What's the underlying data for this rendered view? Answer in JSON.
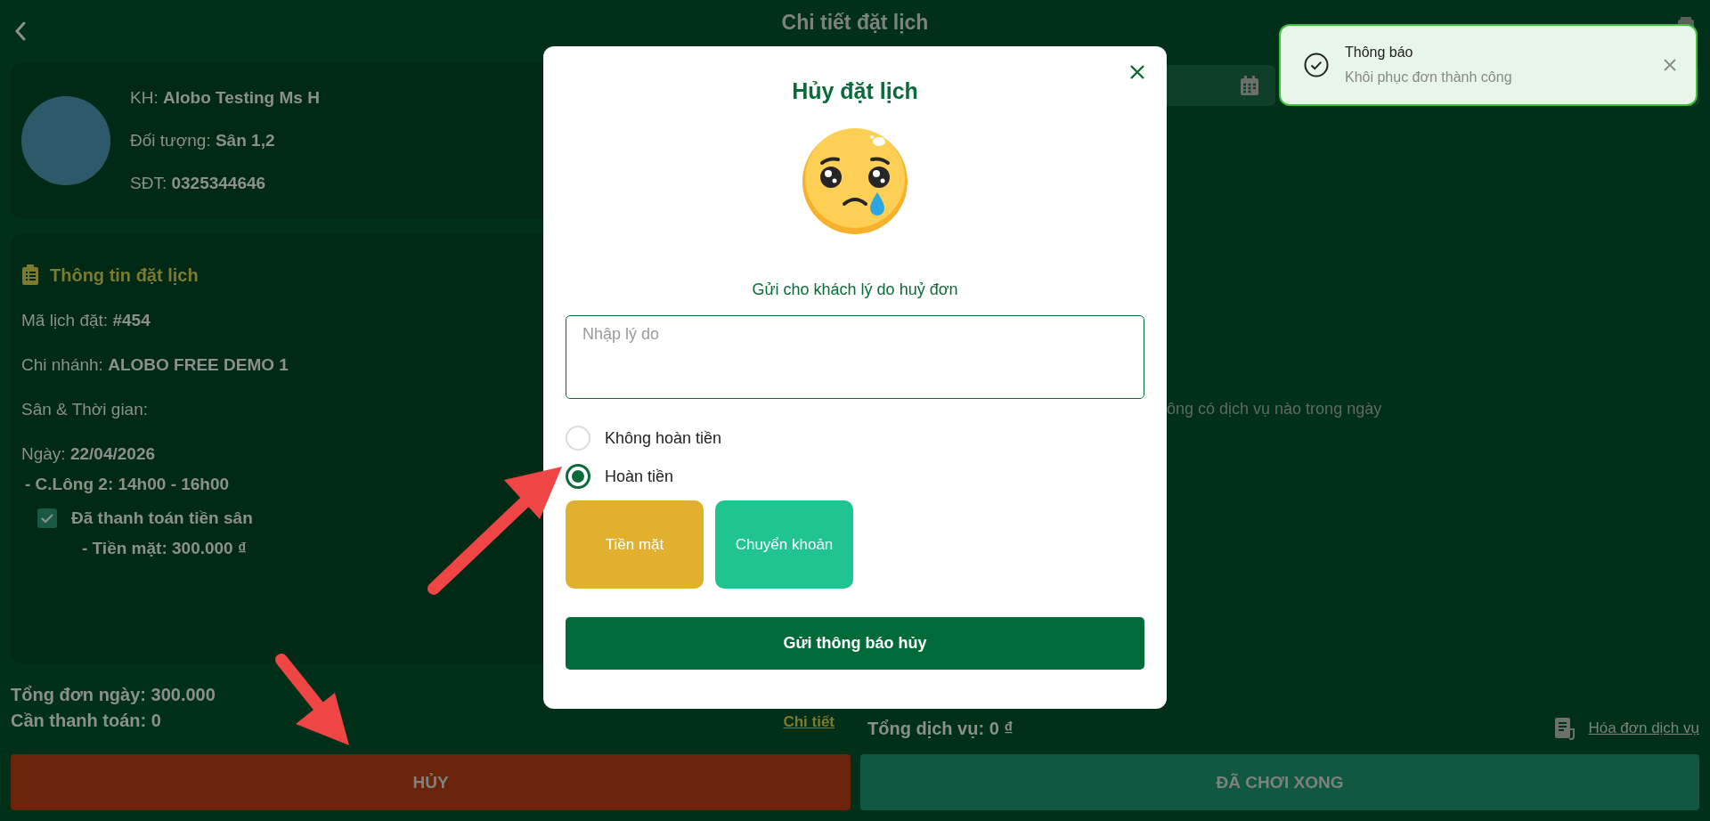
{
  "header": {
    "title": "Chi tiết đặt lịch"
  },
  "customer": {
    "fields": [
      "KH: **Alobo Testing Ms H**",
      "Đối tượng: **Sân 1,2**",
      "SĐT: **0325344646**"
    ]
  },
  "booking_info": {
    "title": "Thông tin đặt lịch",
    "fields": [
      "Mã lịch đặt: **#454**",
      "Chi nhánh: **ALOBO FREE DEMO 1**",
      "Sân & Thời gian:",
      "Ngày: **22/04/2026**"
    ],
    "slot": "- C.Lông 2: 14h00 - 16h00",
    "payment": {
      "label": "Đã thanh toán tiền sân",
      "checked": true
    },
    "payment_detail": "- Tiền mặt: 300.000 ₫"
  },
  "totals": {
    "day_total": "Tổng đơn ngày: 300.000",
    "to_pay": "Cần thanh toán: 0",
    "detail_link": "Chi tiết"
  },
  "services": {
    "empty_text": "ông có dịch vụ nào trong ngày",
    "total": "Tổng dịch vụ: 0 ₫",
    "invoice_link": "Hóa đơn dịch vụ"
  },
  "actions": {
    "cancel": "HỦY",
    "done": "ĐÃ CHƠI XONG"
  },
  "modal": {
    "title": "Hủy đặt lịch",
    "subtitle": "Gửi cho khách lý do huỷ đơn",
    "reason_placeholder": "Nhập lý do",
    "refund_options": [
      {
        "label": "Không hoàn tiền",
        "selected": false
      },
      {
        "label": "Hoàn tiền",
        "selected": true
      }
    ],
    "payment_methods": [
      {
        "label": "Tiền mặt",
        "color": "#e0b02e"
      },
      {
        "label": "Chuyển khoản",
        "color": "#20c490"
      }
    ],
    "submit": "Gửi thông báo hủy"
  },
  "toast": {
    "title": "Thông báo",
    "message": "Khôi phục đơn thành công"
  }
}
